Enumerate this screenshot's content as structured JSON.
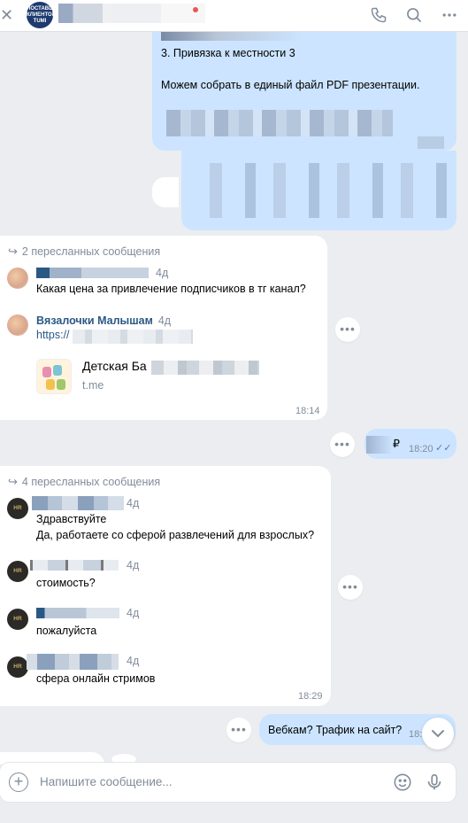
{
  "header": {
    "avatar_text": "ПОСТАВЩИК КЛИЕНТОВ TUMI"
  },
  "out_msg_1": {
    "lines": [
      "3. Привязка к местности 3",
      "",
      "Можем собрать в единый файл PDF презентации."
    ]
  },
  "fwd_1": {
    "label": "2 пересланных сообщения",
    "messages": [
      {
        "age": "4д",
        "text": "Какая цена за привлечение подписчиков в тг канал?"
      },
      {
        "sender": "Вязалочки Малышам",
        "age": "4д",
        "text": "https://"
      }
    ],
    "link_card": {
      "title": "Детская Ба",
      "domain": "t.me"
    },
    "time": "18:14"
  },
  "out_msg_2": {
    "text": "₽",
    "time": "18:20"
  },
  "fwd_2": {
    "label": "4 пересланных сообщения",
    "messages": [
      {
        "age": "4д",
        "text1": "Здравствуйте",
        "text2": "Да, работаете со сферой развлечений для взрослых?"
      },
      {
        "age": "4д",
        "text": "стоимость?"
      },
      {
        "age": "4д",
        "text": "пожалуйста"
      },
      {
        "age": "4д",
        "text": "сфера онлайн стримов"
      }
    ],
    "time": "18:29"
  },
  "out_msg_3": {
    "text": "Вебкам? Трафик на сайт?",
    "time": "18:"
  },
  "composer": {
    "placeholder": "Напишите сообщение..."
  },
  "colors": {
    "accent": "#2a5885",
    "outgoing": "#cce4ff",
    "incoming": "#ffffff",
    "background": "#ebedf0"
  }
}
